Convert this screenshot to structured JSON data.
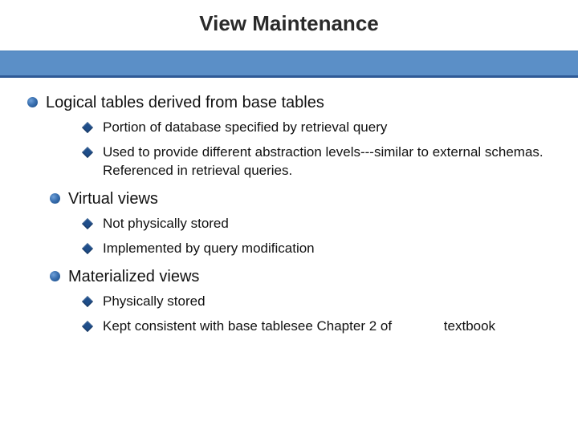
{
  "title": "View Maintenance",
  "items": [
    {
      "text": "Logical tables derived from base tables",
      "indent": false,
      "subs": [
        " Portion of database specified by retrieval query",
        " Used to provide different abstraction levels---similar to  external schemas.  Referenced in retrieval queries."
      ]
    },
    {
      "text": "Virtual views",
      "indent": true,
      "subs": [
        " Not physically stored",
        " Implemented by query modification"
      ]
    },
    {
      "text": "Materialized views",
      "indent": true,
      "subs": [
        " Physically stored",
        " Kept consistent with base tablesee  Chapter 2 of",
        "__tail:textbook"
      ]
    }
  ]
}
